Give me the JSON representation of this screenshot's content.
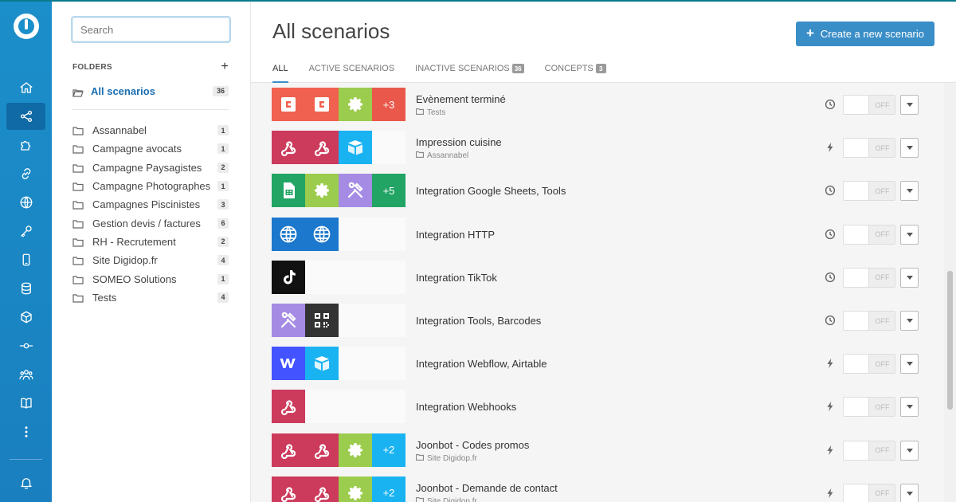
{
  "search": {
    "placeholder": "Search"
  },
  "folders": {
    "header": "FOLDERS",
    "add_label": "+",
    "all": {
      "label": "All scenarios",
      "count": "36"
    },
    "items": [
      {
        "label": "Assannabel",
        "count": "1"
      },
      {
        "label": "Campagne avocats",
        "count": "1"
      },
      {
        "label": "Campagne Paysagistes",
        "count": "2"
      },
      {
        "label": "Campagne Photographes",
        "count": "1"
      },
      {
        "label": "Campagnes Piscinistes",
        "count": "3"
      },
      {
        "label": "Gestion devis / factures",
        "count": "6"
      },
      {
        "label": "RH - Recrutement",
        "count": "2"
      },
      {
        "label": "Site Digidop.fr",
        "count": "4"
      },
      {
        "label": "SOMEO Solutions",
        "count": "1"
      },
      {
        "label": "Tests",
        "count": "4"
      }
    ]
  },
  "main": {
    "title": "All scenarios",
    "create_label": "Create a new scenario",
    "tabs": [
      {
        "label": "ALL",
        "badge": ""
      },
      {
        "label": "ACTIVE SCENARIOS",
        "badge": ""
      },
      {
        "label": "INACTIVE SCENARIOS",
        "badge": "36"
      },
      {
        "label": "CONCEPTS",
        "badge": "3"
      }
    ],
    "toggle_off_label": "OFF"
  },
  "scenarios": [
    {
      "name": "Evènement terminé",
      "folder": "Tests",
      "trigger": "clock",
      "tiles": [
        {
          "color": "#f0614f",
          "icon": "calendar-c-icon"
        },
        {
          "color": "#f0614f",
          "icon": "calendar-c-icon"
        },
        {
          "color": "#9ccc4d",
          "icon": "gear-icon"
        },
        {
          "color": "#e9584a",
          "text": "+3"
        }
      ]
    },
    {
      "name": "Impression cuisine",
      "folder": "Assannabel",
      "trigger": "bolt",
      "tiles": [
        {
          "color": "#cc3a5c",
          "icon": "webhook-icon"
        },
        {
          "color": "#cc3a5c",
          "icon": "webhook-icon"
        },
        {
          "color": "#1ab3f2",
          "icon": "airtable-icon"
        }
      ]
    },
    {
      "name": "Integration Google Sheets, Tools",
      "folder": "",
      "trigger": "clock",
      "tiles": [
        {
          "color": "#21a464",
          "icon": "sheets-icon"
        },
        {
          "color": "#9ccc4d",
          "icon": "gear-icon"
        },
        {
          "color": "#a58be4",
          "icon": "tools-icon"
        },
        {
          "color": "#21a464",
          "text": "+5"
        }
      ]
    },
    {
      "name": "Integration HTTP",
      "folder": "",
      "trigger": "clock",
      "tiles": [
        {
          "color": "#1c78cc",
          "icon": "globe-icon"
        },
        {
          "color": "#1c78cc",
          "icon": "globe-icon"
        }
      ]
    },
    {
      "name": "Integration TikTok",
      "folder": "",
      "trigger": "clock",
      "tiles": [
        {
          "color": "#111111",
          "icon": "tiktok-icon"
        }
      ]
    },
    {
      "name": "Integration Tools, Barcodes",
      "folder": "",
      "trigger": "clock",
      "tiles": [
        {
          "color": "#a58be4",
          "icon": "tools-icon"
        },
        {
          "color": "#333333",
          "icon": "qr-icon"
        }
      ]
    },
    {
      "name": "Integration Webflow, Airtable",
      "folder": "",
      "trigger": "bolt",
      "tiles": [
        {
          "color": "#4353ff",
          "icon": "webflow-icon"
        },
        {
          "color": "#1ab3f2",
          "icon": "airtable-icon"
        }
      ]
    },
    {
      "name": "Integration Webhooks",
      "folder": "",
      "trigger": "bolt",
      "tiles": [
        {
          "color": "#cc3a5c",
          "icon": "webhook-icon"
        }
      ]
    },
    {
      "name": "Joonbot - Codes promos",
      "folder": "Site Digidop.fr",
      "trigger": "bolt",
      "tiles": [
        {
          "color": "#cc3a5c",
          "icon": "webhook-icon"
        },
        {
          "color": "#cc3a5c",
          "icon": "webhook-icon"
        },
        {
          "color": "#9ccc4d",
          "icon": "gear-icon"
        },
        {
          "color": "#1ab3f2",
          "text": "+2"
        }
      ]
    },
    {
      "name": "Joonbot - Demande de contact",
      "folder": "Site Digidop.fr",
      "trigger": "bolt",
      "tiles": [
        {
          "color": "#cc3a5c",
          "icon": "webhook-icon"
        },
        {
          "color": "#cc3a5c",
          "icon": "webhook-icon"
        },
        {
          "color": "#9ccc4d",
          "icon": "gear-icon"
        },
        {
          "color": "#1ab3f2",
          "text": "+2"
        }
      ]
    }
  ]
}
